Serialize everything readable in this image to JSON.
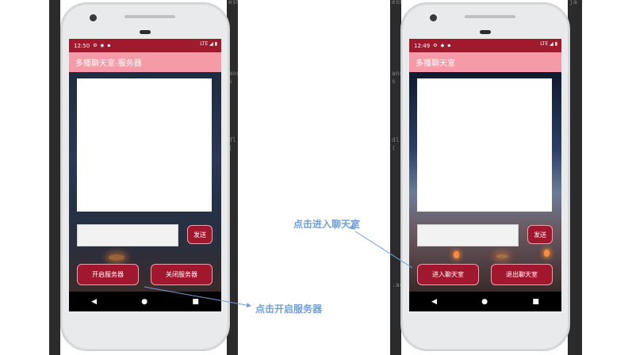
{
  "left_phone": {
    "status_time": "12:50",
    "status_right": "LTE",
    "app_title": "多播聊天室-服务器",
    "send_label": "发送",
    "button_left": "开启服务器",
    "button_right": "关闭服务器",
    "nav": {
      "back": "◀",
      "home": "●",
      "recents": "■"
    }
  },
  "right_phone": {
    "status_time": "12:49",
    "status_right": "LTE",
    "app_title": "多播聊天室",
    "send_label": "发送",
    "button_left": "进入聊天室",
    "button_right": "退出聊天室",
    "nav": {
      "back": "◀",
      "home": "●",
      "recents": "■"
    }
  },
  "annotations": {
    "enter_chat": "点击进入聊天室",
    "start_server": "点击开启服务器"
  },
  "colors": {
    "status_bar": "#9d1b2c",
    "app_bar": "#f59ba7",
    "button": "#a1172d",
    "annotation": "#6f9fdb"
  }
}
